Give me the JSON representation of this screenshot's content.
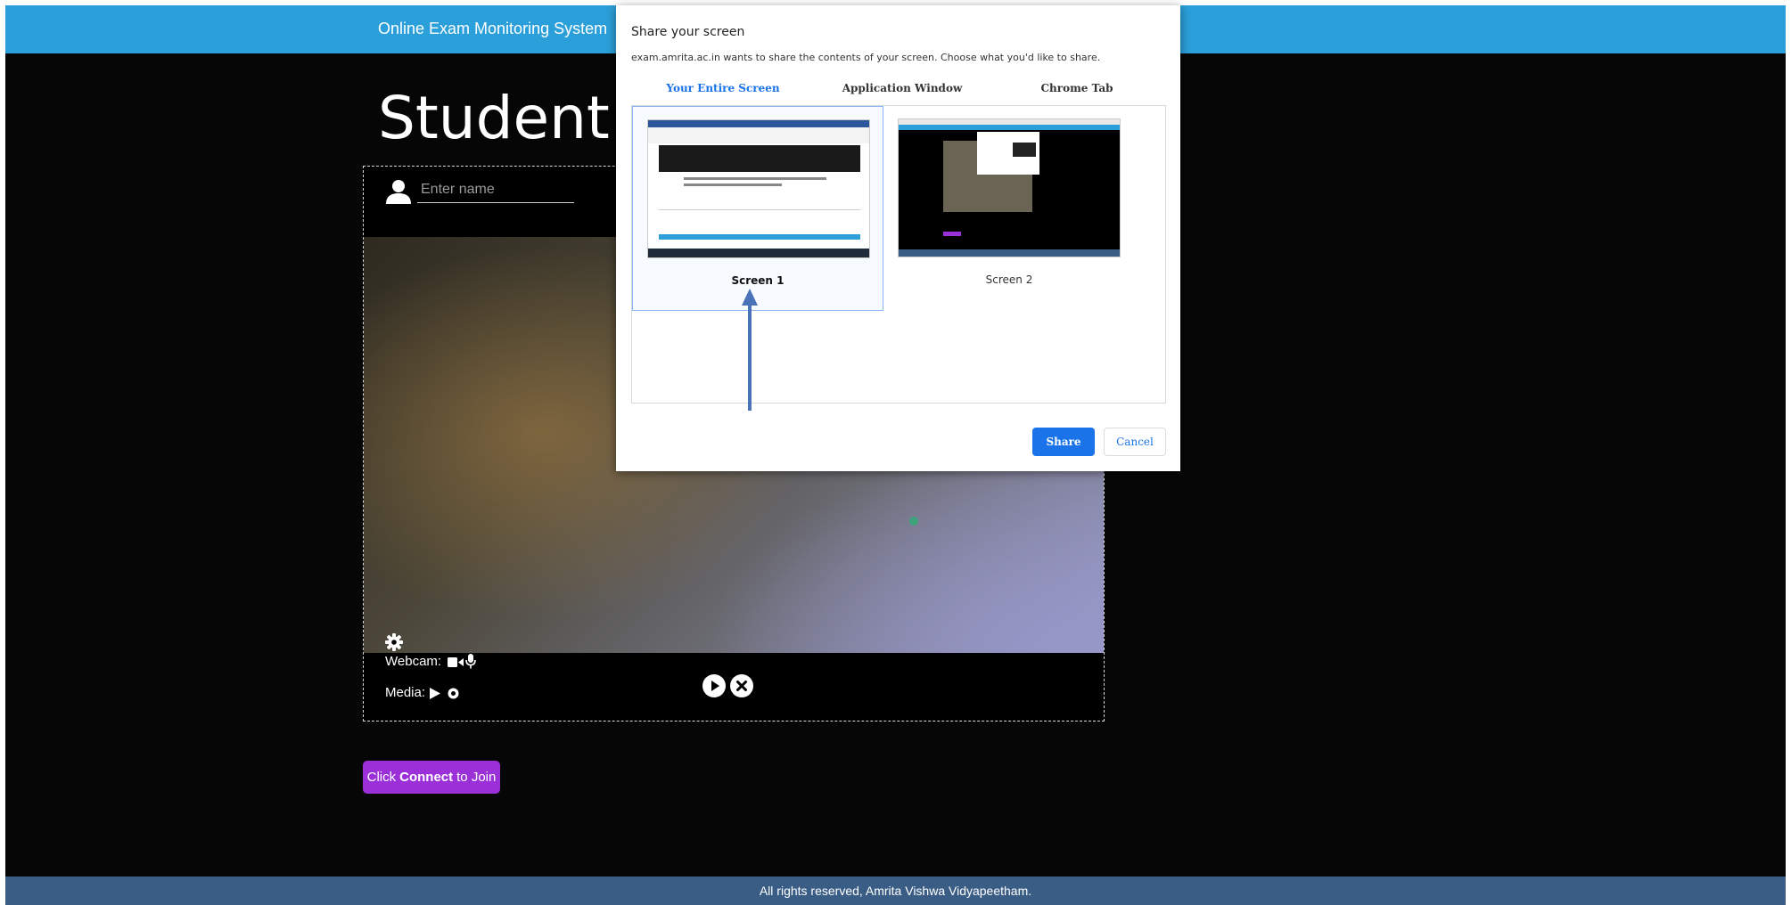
{
  "header": {
    "brand": "Online Exam Monitoring System"
  },
  "page_title": "Student C",
  "panel": {
    "name_placeholder": "Enter name",
    "webcam_label": "Webcam:",
    "media_label": "Media:"
  },
  "connect": {
    "prefix": "Click",
    "bold": "Connect",
    "suffix": "to Join"
  },
  "footer": {
    "text": "All rights reserved, Amrita Vishwa Vidyapeetham."
  },
  "dialog": {
    "title": "Share your screen",
    "subtitle": "exam.amrita.ac.in wants to share the contents of your screen. Choose what you'd like to share.",
    "tabs": [
      {
        "label": "Your Entire Screen",
        "active": true
      },
      {
        "label": "Application Window",
        "active": false
      },
      {
        "label": "Chrome Tab",
        "active": false
      }
    ],
    "sources": [
      {
        "label": "Screen 1",
        "selected": true
      },
      {
        "label": "Screen 2",
        "selected": false
      }
    ],
    "share_label": "Share",
    "cancel_label": "Cancel"
  },
  "colors": {
    "topbar": "#2b9fd9",
    "footer": "#3a5d86",
    "connect": "#9b30d8",
    "accent": "#1a73e8",
    "arrow": "#4a72b8"
  }
}
